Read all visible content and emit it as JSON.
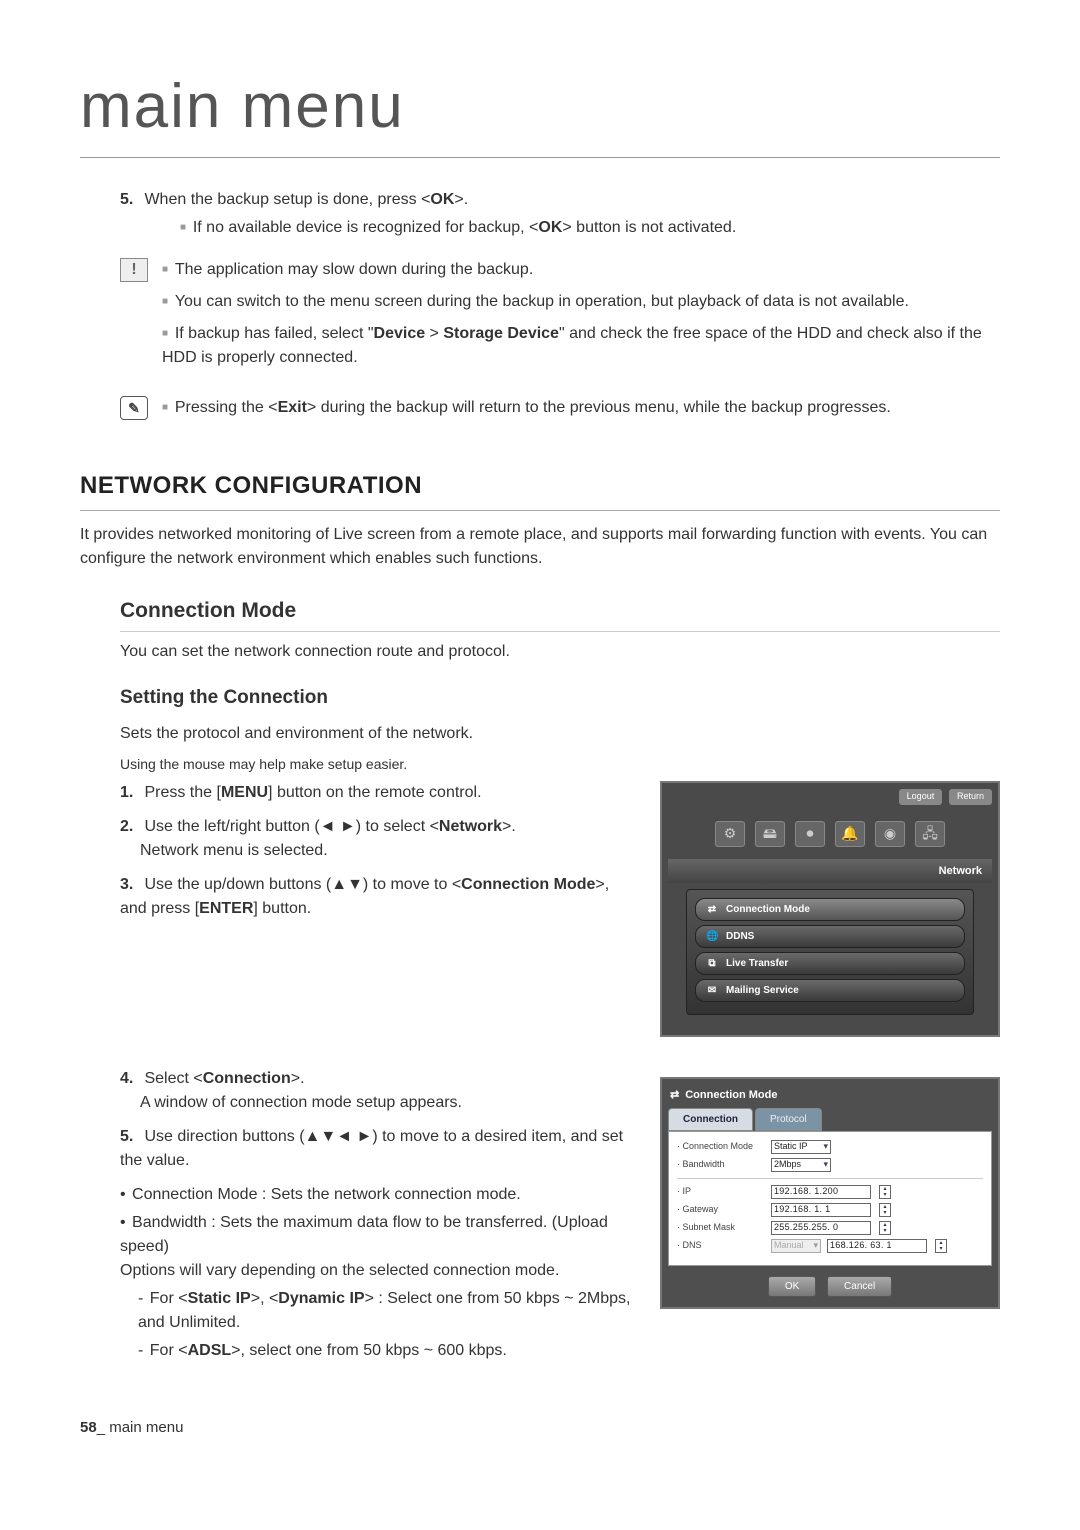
{
  "page_title": "main menu",
  "step5": {
    "num": "5.",
    "text_before": "When the backup setup is done, press <",
    "ok": "OK",
    "text_after": ">.",
    "sub_before": "If no available device is recognized for backup, <",
    "sub_ok": "OK",
    "sub_after": "> button is not activated."
  },
  "caution": {
    "items": [
      "The application may slow down during the backup.",
      "You can switch to the menu screen during the backup in operation, but playback of data is not available."
    ],
    "item3_a": "If backup has failed, select \"",
    "item3_device": "Device",
    "item3_gt": " > ",
    "item3_storage": "Storage Device",
    "item3_b": "\" and check the free space of the HDD and check also if the HDD is properly connected."
  },
  "note": {
    "a": "Pressing the <",
    "exit": "Exit",
    "b": "> during the backup will return to the previous menu, while the backup progresses."
  },
  "section_title": "NETWORK CONFIGURATION",
  "section_desc": "It provides networked monitoring of Live screen from a remote place, and supports mail forwarding function with events. You can configure the network environment which enables such functions.",
  "subsection_title": "Connection Mode",
  "sub_desc": "You can set the network connection route and protocol.",
  "subsub_title": "Setting the Connection",
  "subsub_desc1": "Sets the protocol and environment of the network.",
  "subsub_desc2": "Using the mouse may help make setup easier.",
  "steps_a": {
    "s1": {
      "num": "1.",
      "a": "Press the [",
      "menu": "MENU",
      "b": "] button on the remote control."
    },
    "s2": {
      "num": "2.",
      "a": "Use the left/right button (◄ ►) to select <",
      "net": "Network",
      "b": ">.",
      "line2": "Network menu is selected."
    },
    "s3": {
      "num": "3.",
      "a": "Use the up/down buttons (▲▼) to move to <",
      "conn": "Connection Mode",
      "b": ">, and press [",
      "enter": "ENTER",
      "c": "] button."
    }
  },
  "osd1": {
    "logout": "Logout",
    "return": "Return",
    "network_label": "Network",
    "items": [
      {
        "icon": "⇄",
        "label": "Connection Mode"
      },
      {
        "icon": "🌐",
        "label": "DDNS"
      },
      {
        "icon": "⧉",
        "label": "Live Transfer"
      },
      {
        "icon": "✉",
        "label": "Mailing Service"
      }
    ]
  },
  "steps_b": {
    "s4": {
      "num": "4.",
      "a": "Select <",
      "conn": "Connection",
      "b": ">.",
      "line2": "A window of connection mode setup appears."
    },
    "s5": {
      "num": "5.",
      "text": "Use direction buttons (▲▼◄ ►) to move to a desired item, and set the value."
    }
  },
  "bullets": {
    "b1": "Connection Mode : Sets the network connection mode.",
    "b2a": "Bandwidth : Sets the maximum data flow to be transferred. (Upload speed)",
    "b2b": "Options will vary depending on the selected connection mode.",
    "d1a": "For <",
    "d1_static": "Static IP",
    "d1_mid": ">, <",
    "d1_dyn": "Dynamic IP",
    "d1b": "> : Select one from 50 kbps ~ 2Mbps, and Unlimited.",
    "d2a": "For <",
    "d2_adsl": "ADSL",
    "d2b": ">, select one from 50 kbps ~ 600 kbps."
  },
  "osd2": {
    "title": "Connection Mode",
    "tab_connection": "Connection",
    "tab_protocol": "Protocol",
    "rows": {
      "conn_mode_lbl": "Connection Mode",
      "conn_mode_val": "Static IP",
      "bandwidth_lbl": "Bandwidth",
      "bandwidth_val": "2Mbps",
      "ip_lbl": "IP",
      "ip_val": "192.168. 1.200",
      "gateway_lbl": "Gateway",
      "gateway_val": "192.168. 1. 1",
      "subnet_lbl": "Subnet Mask",
      "subnet_val": "255.255.255. 0",
      "dns_lbl": "DNS",
      "dns_dd": "Manual",
      "dns_val": "168.126. 63. 1"
    },
    "ok": "OK",
    "cancel": "Cancel"
  },
  "footer": {
    "page": "58",
    "sep": "_ ",
    "label": "main menu"
  }
}
